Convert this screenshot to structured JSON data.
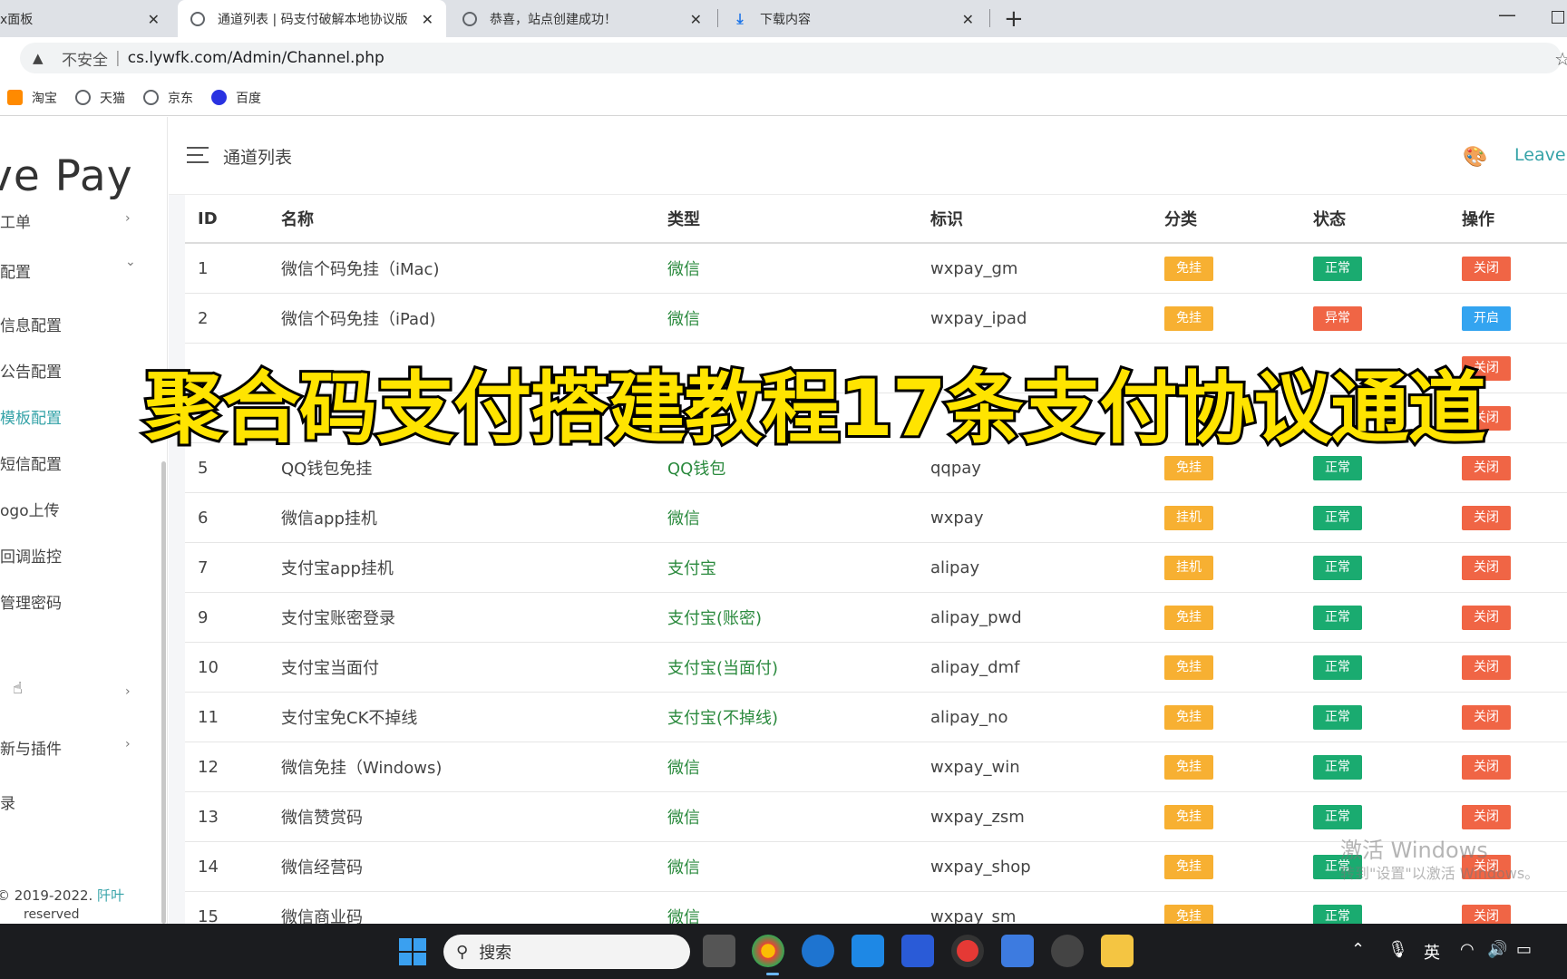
{
  "browser": {
    "tabs": [
      {
        "title": "x面板",
        "active": false
      },
      {
        "title": "通道列表 | 码支付破解本地协议版",
        "active": true
      },
      {
        "title": "恭喜，站点创建成功！",
        "active": false
      },
      {
        "title": "下载内容",
        "active": false
      }
    ],
    "insecure_label": "不安全",
    "url": "cs.lywfk.com/Admin/Channel.php",
    "bookmarks": [
      "淘宝",
      "天猫",
      "京东",
      "百度"
    ]
  },
  "sidebar": {
    "brand": "ve Pay",
    "items": [
      {
        "label": "工单",
        "chevron": "›"
      },
      {
        "label": "配置",
        "chevron": "⌄"
      },
      {
        "label": "信息配置"
      },
      {
        "label": "公告配置"
      },
      {
        "label": "模板配置"
      },
      {
        "label": "短信配置"
      },
      {
        "label": "ogo上传"
      },
      {
        "label": "回调监控"
      },
      {
        "label": "管理密码"
      },
      {
        "label": "",
        "chevron": "›"
      },
      {
        "label": "新与插件",
        "chevron": "›"
      },
      {
        "label": "录"
      }
    ],
    "footer_prefix": "© 2019-2022.",
    "footer_link": "阡叶",
    "footer_line2": "reserved"
  },
  "header": {
    "title": "通道列表",
    "user": "Leave P"
  },
  "table": {
    "columns": [
      "ID",
      "名称",
      "类型",
      "标识",
      "分类",
      "状态",
      "操作"
    ],
    "rows": [
      {
        "id": "1",
        "name": "微信个码免挂（iMac)",
        "type": "微信",
        "code": "wxpay_gm",
        "cat": "免挂",
        "status": "正常",
        "op": "关闭"
      },
      {
        "id": "2",
        "name": "微信个码免挂（iPad)",
        "type": "微信",
        "code": "wxpay_ipad",
        "cat": "免挂",
        "status": "异常",
        "op": "开启"
      },
      {
        "id": "",
        "name": "",
        "type": "",
        "code": "",
        "cat": "",
        "status": "",
        "op": "关闭"
      },
      {
        "id": "",
        "name": "",
        "type": "",
        "code": "",
        "cat": "",
        "status": "",
        "op": "关闭"
      },
      {
        "id": "5",
        "name": "QQ钱包免挂",
        "type": "QQ钱包",
        "code": "qqpay",
        "cat": "免挂",
        "status": "正常",
        "op": "关闭"
      },
      {
        "id": "6",
        "name": "微信app挂机",
        "type": "微信",
        "code": "wxpay",
        "cat": "挂机",
        "status": "正常",
        "op": "关闭"
      },
      {
        "id": "7",
        "name": "支付宝app挂机",
        "type": "支付宝",
        "code": "alipay",
        "cat": "挂机",
        "status": "正常",
        "op": "关闭"
      },
      {
        "id": "9",
        "name": "支付宝账密登录",
        "type": "支付宝(账密)",
        "code": "alipay_pwd",
        "cat": "免挂",
        "status": "正常",
        "op": "关闭"
      },
      {
        "id": "10",
        "name": "支付宝当面付",
        "type": "支付宝(当面付)",
        "code": "alipay_dmf",
        "cat": "免挂",
        "status": "正常",
        "op": "关闭"
      },
      {
        "id": "11",
        "name": "支付宝免CK不掉线",
        "type": "支付宝(不掉线)",
        "code": "alipay_no",
        "cat": "免挂",
        "status": "正常",
        "op": "关闭"
      },
      {
        "id": "12",
        "name": "微信免挂（Windows)",
        "type": "微信",
        "code": "wxpay_win",
        "cat": "免挂",
        "status": "正常",
        "op": "关闭"
      },
      {
        "id": "13",
        "name": "微信赞赏码",
        "type": "微信",
        "code": "wxpay_zsm",
        "cat": "免挂",
        "status": "正常",
        "op": "关闭"
      },
      {
        "id": "14",
        "name": "微信经营码",
        "type": "微信",
        "code": "wxpay_shop",
        "cat": "免挂",
        "status": "正常",
        "op": "关闭"
      },
      {
        "id": "15",
        "name": "微信商业码",
        "type": "微信",
        "code": "wxpay_sm",
        "cat": "免挂",
        "status": "正常",
        "op": "关闭"
      }
    ]
  },
  "overlay": {
    "banner": "聚合码支付搭建教程17条支付协议通道"
  },
  "watermark": {
    "line1": "激活 Windows",
    "line2": "转到\"设置\"以激活 Windows。"
  },
  "taskbar": {
    "search_placeholder": "搜索",
    "ime": "英"
  },
  "colors": {
    "accent": "#36a3a8",
    "type_green": "#2b8a3e",
    "badge_orange": "#f7b032",
    "badge_green": "#1aab70",
    "badge_red": "#f06545",
    "badge_blue": "#33a4f0",
    "banner_yellow": "#ffe400"
  }
}
